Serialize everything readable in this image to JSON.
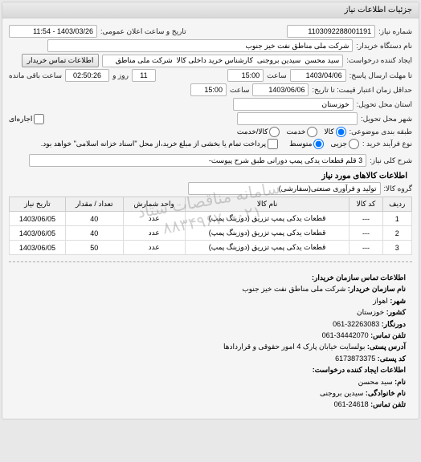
{
  "panel_title": "جزئیات اطلاعات نیاز",
  "labels": {
    "req_no": "شماره نیاز:",
    "announce_dt": "تاریخ و ساعت اعلان عمومی:",
    "buyer_org": "نام دستگاه خریدار:",
    "creator": "ایجاد کننده درخواست:",
    "contact_btn": "اطلاعات تماس خریدار",
    "deadline_to": "تا مهلت ارسال پاسخ:",
    "remaining": "روز و",
    "remaining2": "ساعت باقی مانده",
    "validity": "حداقل زمان اعتبار قیمت: تا تاریخ:",
    "province": "استان محل تحویل:",
    "city": "شهر محل تحویل:",
    "rent": "اجاره‌ای",
    "pkg_type": "طبقه بندی موضوعی:",
    "opt_goods": "کالا",
    "opt_service": "خدمت",
    "opt_goods_svc": "کالا/خدمت",
    "process_type": "نوع فرآیند خرید :",
    "opt_small": "جزیی",
    "opt_medium": "متوسط",
    "pay_note": "پرداخت تمام یا بخشی از مبلغ خرید،از محل \"اسناد خزانه اسلامی\" خواهد بود.",
    "summary": "شرح کلی نیاز:",
    "items_title": "اطلاعات کالاهای مورد نیاز",
    "group": "گروه کالا:",
    "contact_title": "اطلاعات تماس سازمان خریدار:",
    "org_name": "نام سازمان خریدار:",
    "city_l": "شهر:",
    "country_l": "کشور:",
    "fax_l": "دورنگار:",
    "phone_l": "تلفن تماس:",
    "postal_addr": "آدرس پستی:",
    "postal_code": "کد پستی:",
    "creator_title": "اطلاعات ایجاد کننده درخواست:",
    "fname": "نام:",
    "lname": "نام خانوادگی:",
    "phone2": "تلفن تماس:"
  },
  "values": {
    "req_no": "1103092288001191",
    "announce_dt": "1403/03/26 - 11:54",
    "buyer_org": "شرکت ملی مناطق نفت خیز جنوب",
    "creator": "سید محسن  سیدین بروجنی  کارشناس خرید داخلی کالا  شرکت ملی مناطق",
    "deadline_date": "1403/04/06",
    "deadline_time": "15:00",
    "remaining_days": "11",
    "remaining_time": "02:50:26",
    "validity_date": "1403/06/06",
    "validity_time": "15:00",
    "province": "خوزستان",
    "city": "",
    "summary": "3 قلم قطعات یدکی پمپ دورانی طبق شرح پیوست-",
    "group": "تولید و فرآوری صنعتی(سفارشی)"
  },
  "table": {
    "headers": [
      "ردیف",
      "کد کالا",
      "نام کالا",
      "واحد شمارش",
      "تعداد / مقدار",
      "تاریخ نیاز"
    ],
    "rows": [
      [
        "1",
        "---",
        "قطعات یدکی پمپ تزریق (دوزینگ پمپ)",
        "عدد",
        "40",
        "1403/06/05"
      ],
      [
        "2",
        "---",
        "قطعات یدکی پمپ تزریق (دوزینگ پمپ)",
        "عدد",
        "40",
        "1403/06/05"
      ],
      [
        "3",
        "---",
        "قطعات یدکی پمپ تزریق (دوزینگ پمپ)",
        "عدد",
        "50",
        "1403/06/05"
      ]
    ]
  },
  "contact": {
    "org": "شرکت ملی مناطق نفت خیز جنوب",
    "city": "اهواز",
    "country": "خوزستان",
    "fax": "32263083-061",
    "phone": "34442070-061",
    "addr": "بولسایت خیابان پارک 4 امور حقوقی و قراردادها",
    "postal": "6173873375",
    "fname": "سید محسن",
    "lname": "سیدین بروجنی",
    "phone2": "24618-061"
  },
  "watermark": "سامانه مناقصات ستاد\n۰۲۱-۸۸۳۴۹۶۷۰"
}
